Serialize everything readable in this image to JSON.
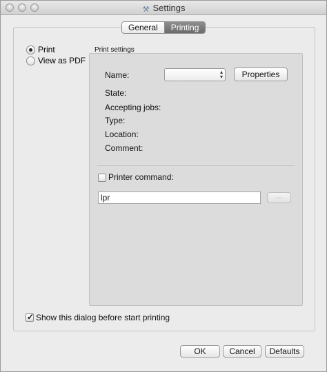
{
  "window": {
    "title": "Settings",
    "title_icon": "wrench-screwdriver-icon"
  },
  "tabs": [
    {
      "label": "General",
      "selected": false
    },
    {
      "label": "Printing",
      "selected": true
    }
  ],
  "output_mode": {
    "options": [
      {
        "label": "Print",
        "selected": true
      },
      {
        "label": "View as PDF",
        "selected": false
      }
    ]
  },
  "print_settings": {
    "group_label": "Print settings",
    "name_label": "Name:",
    "name_value": "",
    "properties_label": "Properties",
    "state_label": "State:",
    "accepting_jobs_label": "Accepting jobs:",
    "type_label": "Type:",
    "location_label": "Location:",
    "comment_label": "Comment:",
    "printer_command_label": "Printer command:",
    "printer_command_checked": false,
    "printer_command_value": "lpr",
    "browse_label": "..."
  },
  "show_dialog": {
    "label": "Show this dialog before start printing",
    "checked": true
  },
  "buttons": {
    "ok": "OK",
    "cancel": "Cancel",
    "defaults": "Defaults"
  }
}
